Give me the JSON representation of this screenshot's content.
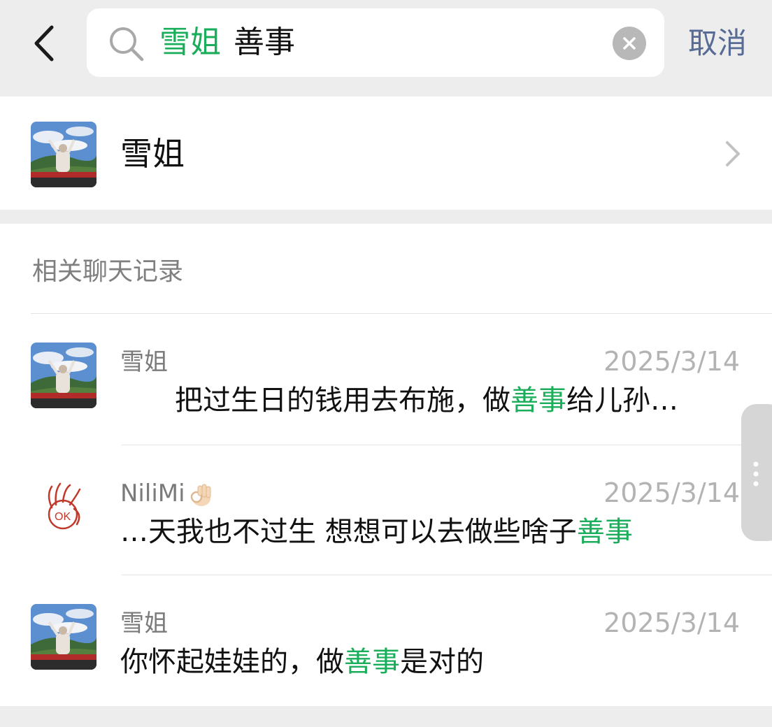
{
  "search": {
    "query_highlight": "雪姐",
    "query_rest": "善事",
    "cancel_label": "取消"
  },
  "contact": {
    "name": "雪姐"
  },
  "records": {
    "title": "相关聊天记录",
    "items": [
      {
        "sender": "雪姐",
        "time": "2025/3/14",
        "msg_before": "把过生日的钱用去布施，做",
        "msg_highlight": "善事",
        "msg_after": "给儿孙…"
      },
      {
        "sender": "NiliMi",
        "sender_emoji": "ok-hand-emoji",
        "time": "2025/3/14",
        "msg_before": "…天我也不过生 想想可以去做些啥子",
        "msg_highlight": "善事",
        "msg_after": ""
      },
      {
        "sender": "雪姐",
        "time": "2025/3/14",
        "msg_before": "你怀起娃娃的，做",
        "msg_highlight": "善事",
        "msg_after": "是对的"
      }
    ]
  },
  "icons": {
    "back": "chevron-left-icon",
    "search": "search-icon",
    "clear": "clear-icon",
    "chevron": "chevron-right-icon",
    "more": "more-vertical-icon"
  },
  "colors": {
    "highlight": "#1aad5a",
    "link": "#576b95",
    "background": "#ededed"
  }
}
